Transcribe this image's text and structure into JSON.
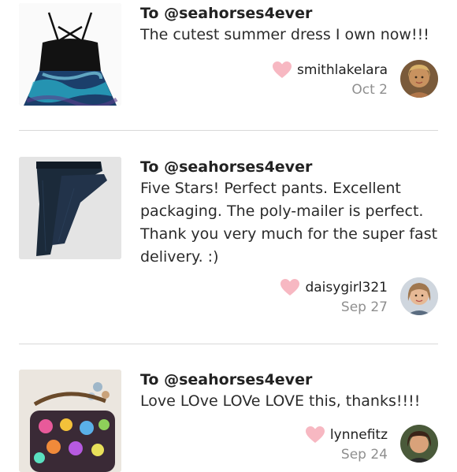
{
  "reviews": [
    {
      "to": "To @seahorses4ever",
      "message": "The cutest summer dress I own now!!!",
      "username": "smithlakelara",
      "date": "Oct 2",
      "thumbnail_icon": "black-tie-dye-dress-photo",
      "avatar_icon": "user-avatar-photo"
    },
    {
      "to": "To @seahorses4ever",
      "message": "Five Stars! Perfect pants. Excellent packaging. The poly-mailer is perfect. Thank you very much for the super fast delivery. :)",
      "username": "daisygirl321",
      "date": "Sep 27",
      "thumbnail_icon": "dark-leggings-photo",
      "avatar_icon": "user-avatar-photo"
    },
    {
      "to": "To @seahorses4ever",
      "message": "Love LOve LOVe LOVE this, thanks!!!!",
      "username": "lynnefitz",
      "date": "Sep 24",
      "thumbnail_icon": "colorful-handbag-photo",
      "avatar_icon": "user-avatar-photo"
    }
  ],
  "colors": {
    "heart": "#f7b8c2",
    "divider": "#d8d8d8",
    "date_text": "#8f8f8f"
  }
}
